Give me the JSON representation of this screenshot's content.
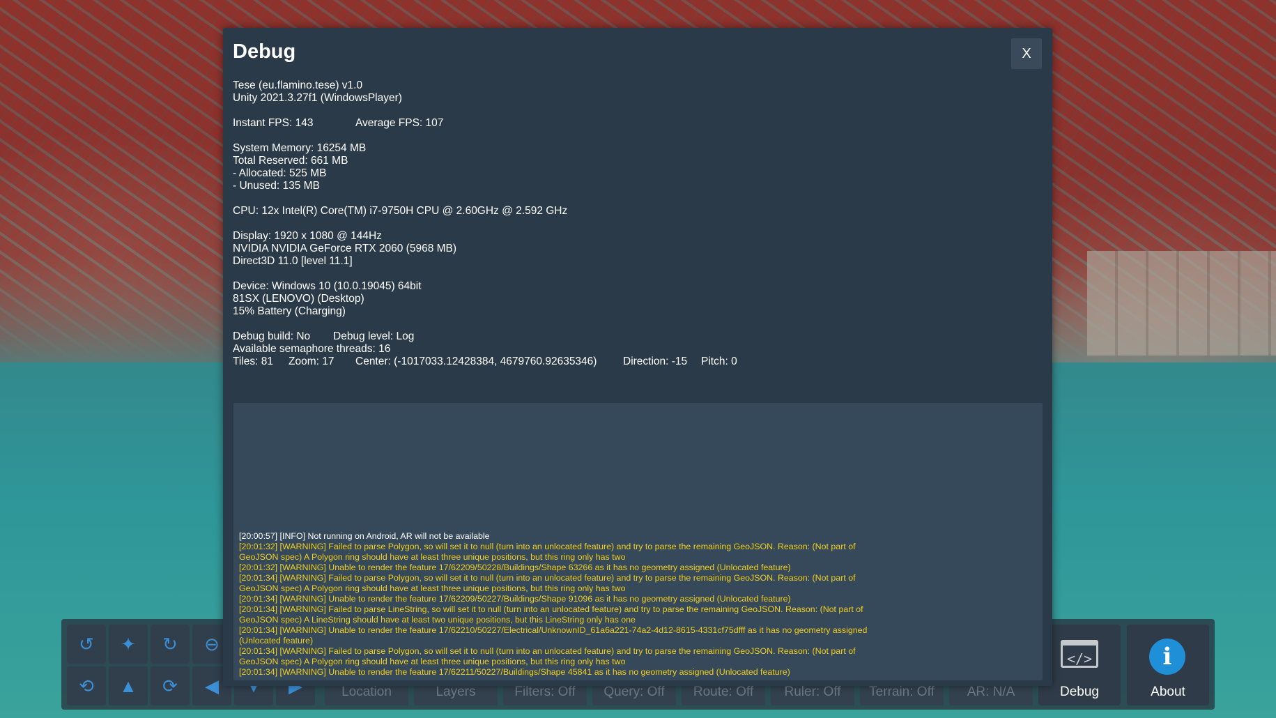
{
  "dialog": {
    "title": "Debug",
    "close_label": "X",
    "app_line": "Tese (eu.flamino.tese) v1.0",
    "unity_line": "Unity 2021.3.27f1 (WindowsPlayer)",
    "instant_fps": "Instant FPS: 143",
    "average_fps": "Average FPS: 107",
    "system_memory": "System Memory: 16254 MB",
    "total_reserved": "Total Reserved: 661 MB",
    "allocated": "- Allocated: 525 MB",
    "unused": "- Unused: 135 MB",
    "cpu": "CPU: 12x Intel(R) Core(TM) i7-9750H CPU @ 2.60GHz @ 2.592 GHz",
    "display": "Display: 1920 x 1080 @ 144Hz",
    "gpu": "NVIDIA NVIDIA GeForce RTX 2060 (5968 MB)",
    "graphics_api": "Direct3D 11.0 [level 11.1]",
    "device": "Device: Windows 10  (10.0.19045) 64bit",
    "model": "81SX (LENOVO) (Desktop)",
    "battery": "15% Battery (Charging)",
    "debug_build": "Debug build: No",
    "debug_level": "Debug level: Log",
    "semaphore_threads": "Available semaphore threads: 16",
    "tiles": "Tiles: 81",
    "zoom": "Zoom: 17",
    "center": "Center: (-1017033.12428384, 4679760.92635346)",
    "direction": "Direction: -15",
    "pitch": "Pitch: 0"
  },
  "console": {
    "entries": [
      {
        "level": "info",
        "text": "[20:00:57] [INFO] Not running on Android, AR will not be available"
      },
      {
        "level": "warning",
        "text": "[20:01:32] [WARNING] Failed to parse Polygon, so will set it to null (turn into an unlocated feature) and try to parse the remaining GeoJSON. Reason: (Not part of GeoJSON spec) A Polygon ring should have at least three unique positions, but this ring only has two"
      },
      {
        "level": "warning",
        "text": "[20:01:32] [WARNING] Unable to render the feature 17/62209/50228/Buildings/Shape 63266 as it has no geometry assigned (Unlocated feature)"
      },
      {
        "level": "warning",
        "text": "[20:01:34] [WARNING] Failed to parse Polygon, so will set it to null (turn into an unlocated feature) and try to parse the remaining GeoJSON. Reason: (Not part of GeoJSON spec) A Polygon ring should have at least three unique positions, but this ring only has two"
      },
      {
        "level": "warning",
        "text": "[20:01:34] [WARNING] Unable to render the feature 17/62209/50227/Buildings/Shape 91096 as it has no geometry assigned (Unlocated feature)"
      },
      {
        "level": "warning",
        "text": "[20:01:34] [WARNING] Failed to parse LineString, so will set it to null (turn into an unlocated feature) and try to parse the remaining GeoJSON. Reason: (Not part of GeoJSON spec) A LineString should have at least two unique positions, but this LineString only has one"
      },
      {
        "level": "warning",
        "text": "[20:01:34] [WARNING] Unable to render the feature 17/62210/50227/Electrical/UnknownID_61a6a221-74a2-4d12-8615-4331cf75dfff as it has no geometry assigned (Unlocated feature)"
      },
      {
        "level": "warning",
        "text": "[20:01:34] [WARNING] Failed to parse Polygon, so will set it to null (turn into an unlocated feature) and try to parse the remaining GeoJSON. Reason: (Not part of GeoJSON spec) A Polygon ring should have at least three unique positions, but this ring only has two"
      },
      {
        "level": "warning",
        "text": "[20:01:34] [WARNING] Unable to render the feature 17/62211/50227/Buildings/Shape 45841 as it has no geometry assigned (Unlocated feature)"
      }
    ]
  },
  "toolbar": {
    "location_label": "Location",
    "layers_label": "Layers",
    "filters_label": "Filters: Off",
    "query_label": "Query: Off",
    "route_label": "Route: Off",
    "ruler_label": "Ruler: Off",
    "terrain_label": "Terrain: Off",
    "ar_label": "AR: N/A",
    "debug_label": "Debug",
    "about_label": "About",
    "debug_icon_glyph": "</>",
    "about_icon_glyph": "i"
  },
  "colors": {
    "dialog_bg": "#2b3a48",
    "console_bg": "#35495a",
    "warning_text": "#f2cf20",
    "info_text": "#ffffff",
    "accent_icon": "#1f8fd8"
  },
  "icons": {
    "map_controls": [
      "rotate-left-icon",
      "compass-icon",
      "rotate-right-icon",
      "zoom-out-icon",
      "tilt-up-icon",
      "pitch-icon",
      "tilt-down-icon",
      "pan-left-icon",
      "pan-down-icon",
      "pan-right-icon"
    ],
    "debug": "code-icon",
    "about": "info-icon"
  }
}
